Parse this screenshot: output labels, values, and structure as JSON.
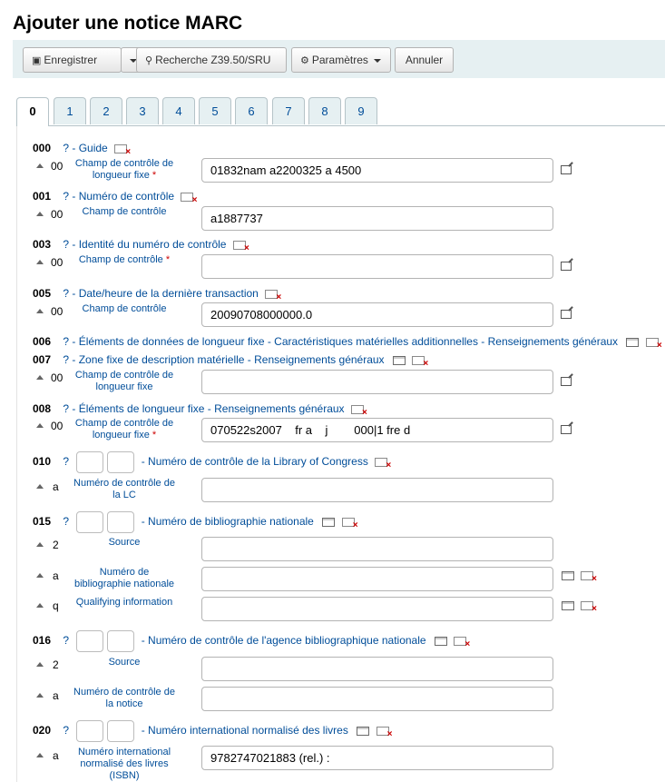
{
  "page_title": "Ajouter une notice MARC",
  "toolbar": {
    "save_label": "Enregistrer",
    "z3950_label": "Recherche Z39.50/SRU",
    "settings_label": "Paramètres",
    "cancel_label": "Annuler"
  },
  "tabs": [
    "0",
    "1",
    "2",
    "3",
    "4",
    "5",
    "6",
    "7",
    "8",
    "9"
  ],
  "help_marker": "?",
  "fields": [
    {
      "tag": "000",
      "desc": "- Guide"
    },
    {
      "tag": "001",
      "desc": "- Numéro de contrôle"
    },
    {
      "tag": "003",
      "desc": "- Identité du numéro de contrôle"
    },
    {
      "tag": "005",
      "desc": "- Date/heure de la dernière transaction"
    },
    {
      "tag": "006",
      "desc": "- Éléments de données de longueur fixe - Caractéristiques matérielles additionnelles - Renseignements généraux"
    },
    {
      "tag": "007",
      "desc": "- Zone fixe de description matérielle - Renseignements généraux"
    },
    {
      "tag": "008",
      "desc": "- Éléments de longueur fixe - Renseignements généraux"
    },
    {
      "tag": "010",
      "desc": "- Numéro de contrôle de la Library of Congress"
    },
    {
      "tag": "015",
      "desc": "- Numéro de bibliographie nationale"
    },
    {
      "tag": "016",
      "desc": "- Numéro de contrôle de l'agence bibliographique nationale"
    },
    {
      "tag": "020",
      "desc": "- Numéro international normalisé des livres"
    }
  ],
  "subfields": [
    {
      "code": "00",
      "label": "Champ de contrôle de longueur fixe",
      "required": "*",
      "value": "01832nam a2200325 a 4500"
    },
    {
      "code": "00",
      "label": "Champ de contrôle",
      "required": "",
      "value": "a1887737"
    },
    {
      "code": "00",
      "label": "Champ de contrôle",
      "required": "*",
      "value": ""
    },
    {
      "code": "00",
      "label": "Champ de contrôle",
      "required": "",
      "value": "20090708000000.0"
    },
    {
      "code": "00",
      "label": "Champ de contrôle de longueur fixe",
      "required": "",
      "value": ""
    },
    {
      "code": "00",
      "label": "Champ de contrôle de longueur fixe",
      "required": "*",
      "value": "070522s2007    fr a    j        000|1 fre d"
    },
    {
      "code": "a",
      "label": "Numéro de contrôle de la LC",
      "required": "",
      "value": ""
    },
    {
      "code": "2",
      "label": "Source",
      "required": "",
      "value": ""
    },
    {
      "code": "a",
      "label": "Numéro de bibliographie nationale",
      "required": "",
      "value": ""
    },
    {
      "code": "q",
      "label": "Qualifying information",
      "required": "",
      "value": ""
    },
    {
      "code": "2",
      "label": "Source",
      "required": "",
      "value": ""
    },
    {
      "code": "a",
      "label": "Numéro de contrôle de la notice",
      "required": "",
      "value": ""
    },
    {
      "code": "a",
      "label": "Numéro international normalisé des livres (ISBN)",
      "required": "",
      "value": "9782747021883 (rel.) :"
    }
  ]
}
